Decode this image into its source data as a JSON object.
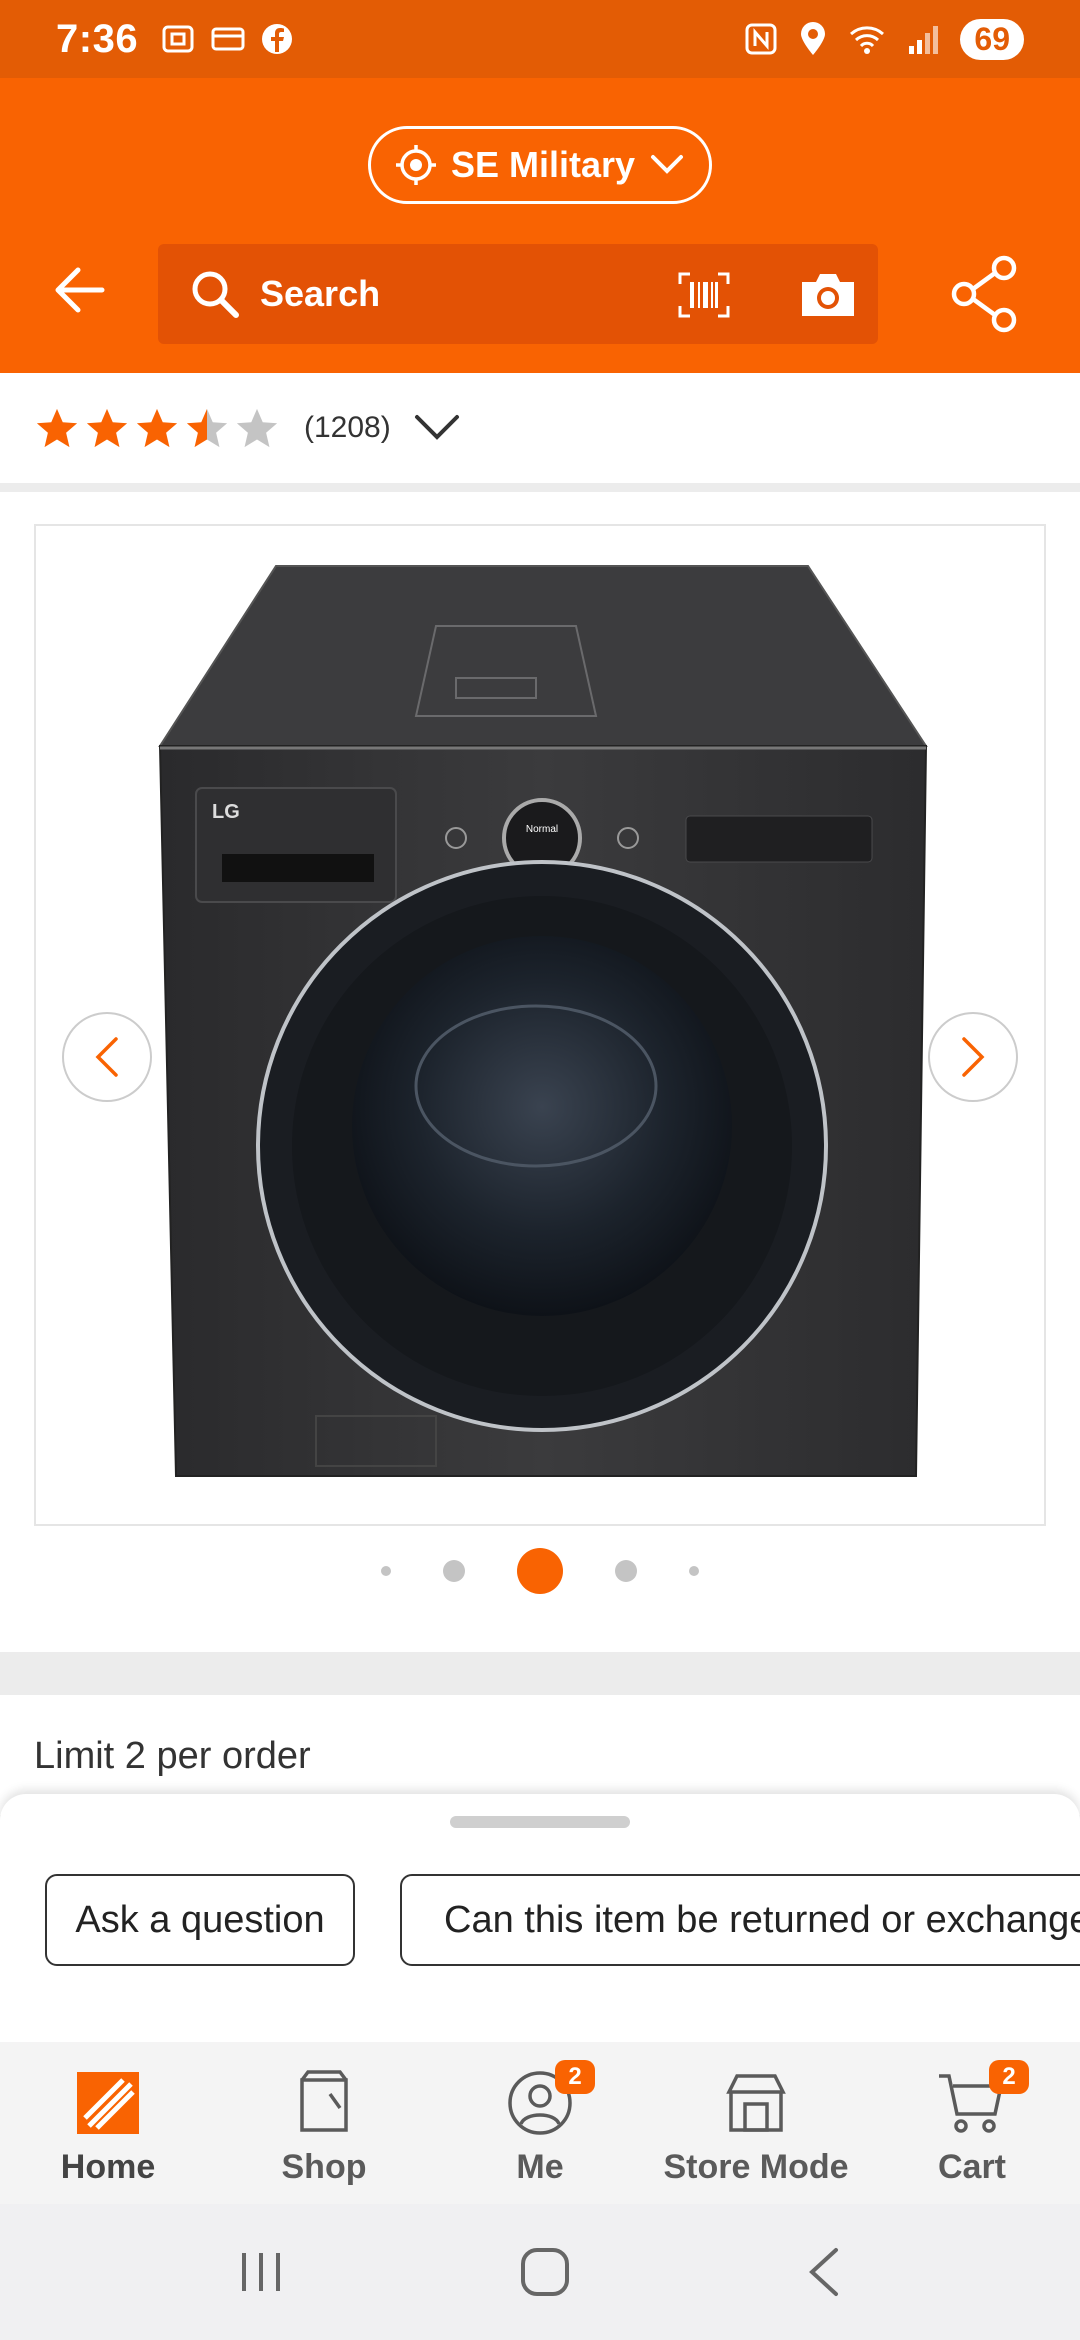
{
  "status_bar": {
    "time": "7:36",
    "battery": "69"
  },
  "header": {
    "store_name": "SE Military",
    "search_placeholder": "Search"
  },
  "rating": {
    "value": 3.5,
    "max": 5,
    "count": "(1208)"
  },
  "gallery": {
    "product_alt": "LG WashCombo washer dryer",
    "brand_label": "LG",
    "panel_label": "Normal",
    "total_images": 5,
    "active_index": 2
  },
  "limit": {
    "text": "Limit 2 per order"
  },
  "sheet": {
    "ask_label": "Ask a question",
    "return_label": "Can this item be returned or exchanged?"
  },
  "bottom_nav": {
    "items": [
      {
        "label": "Home",
        "badge": ""
      },
      {
        "label": "Shop",
        "badge": ""
      },
      {
        "label": "Me",
        "badge": "2"
      },
      {
        "label": "Store Mode",
        "badge": ""
      },
      {
        "label": "Cart",
        "badge": "2"
      }
    ]
  },
  "colors": {
    "brand_orange": "#f96302",
    "status_orange": "#e35c05",
    "star": "#f96302",
    "star_empty": "#c4c4c4"
  }
}
